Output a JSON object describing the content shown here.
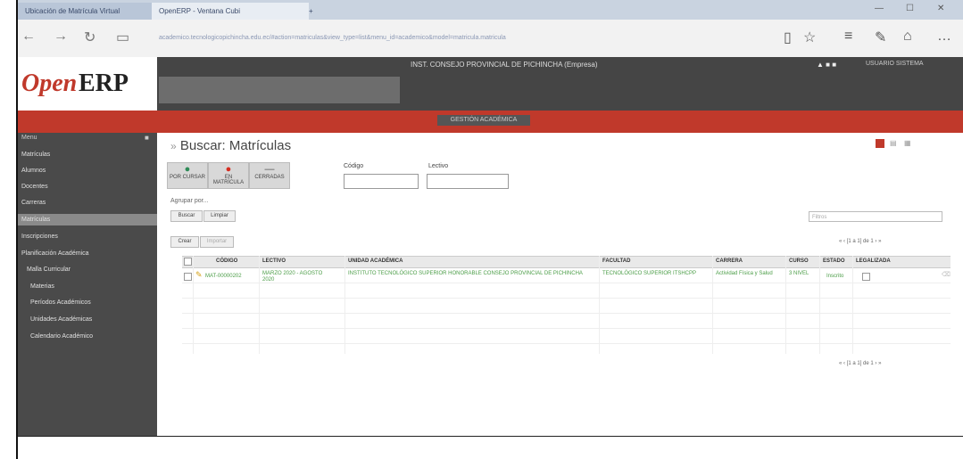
{
  "browser": {
    "tabs": [
      {
        "label": "Ubicación de Matrícula Virtual"
      },
      {
        "label": "OpenERP - Ventana Cubi"
      },
      {
        "label": "+"
      }
    ],
    "url": "academico.tecnologicopichincha.edu.ec/#action=matriculas&view_type=list&menu_id=academico&model=matricula.matricula"
  },
  "app": {
    "logo_open": "Open",
    "logo_erp": "ERP",
    "header_title": "INST. CONSEJO PROVINCIAL DE PICHINCHA (Empresa)",
    "user": "USUARIO SISTEMA",
    "menu_item": "GESTIÓN ACADÉMICA"
  },
  "sidebar": {
    "header": "Menu",
    "items": [
      {
        "label": "Matrículas"
      },
      {
        "label": "Alumnos"
      },
      {
        "label": "Docentes"
      },
      {
        "label": "Carreras"
      },
      {
        "label": "Matrículas"
      },
      {
        "label": "Inscripciones"
      },
      {
        "label": "Planificación Académica"
      },
      {
        "label": "Malla Curricular"
      },
      {
        "label": "Materias"
      },
      {
        "label": "Períodos Académicos"
      },
      {
        "label": "Unidades Académicas"
      },
      {
        "label": "Calendario Académico"
      }
    ],
    "selected_index": 4
  },
  "view": {
    "breadcrumb": "»",
    "title": "Buscar: Matrículas",
    "filters": [
      {
        "label": "POR CURSAR",
        "color": "#2e8b57",
        "icon": "●"
      },
      {
        "label": "EN MATRÍCULA",
        "color": "#d62d20",
        "icon": "●"
      },
      {
        "label": "CERRADAS",
        "color": "#555555",
        "icon": "—"
      }
    ],
    "fields": {
      "code_label": "Código",
      "lective_label": "Lectivo",
      "code_value": "",
      "lective_value": ""
    },
    "group_by": "Agrupar por...",
    "search_button": "Buscar",
    "clear_button": "Limpiar",
    "create_button": "Crear",
    "import_button": "Importar",
    "filter_select": "Filtros",
    "pager": "[1 a 1] de 1",
    "pager_bottom": "[1 a 1] de 1"
  },
  "table": {
    "columns": [
      "CÓDIGO",
      "LECTIVO",
      "UNIDAD ACADÉMICA",
      "FACULTAD",
      "CARRERA",
      "CURSO",
      "ESTADO",
      "LEGALIZADA"
    ],
    "rows": [
      {
        "code": "MAT-00000202",
        "lective": "MARZO 2020 - AGOSTO 2020",
        "unit": "INSTITUTO TECNOLÓGICO SUPERIOR HONORABLE CONSEJO PROVINCIAL DE PICHINCHA",
        "faculty": "TECNOLÓGICO SUPERIOR ITSHCPP",
        "career": "Actividad Física y Salud",
        "course": "3 NIVEL",
        "state": "Inscrito",
        "legalized": ""
      }
    ]
  }
}
